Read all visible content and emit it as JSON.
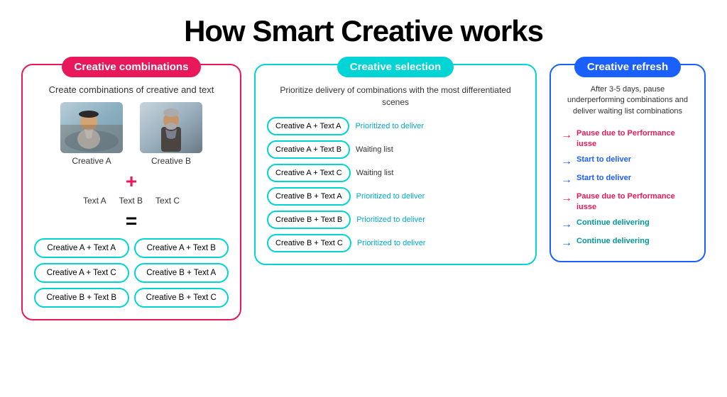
{
  "page": {
    "title": "How Smart Creative works"
  },
  "left": {
    "header": "Creative combinations",
    "create_text": "Create combinations of creative and text",
    "creative_a_label": "Creative A",
    "creative_b_label": "Creative B",
    "plus": "+",
    "texts": [
      "Text A",
      "Text B",
      "Text C"
    ],
    "equals": "=",
    "combos": [
      "Creative A + Text A",
      "Creative A + Text B",
      "Creative A + Text C",
      "Creative B + Text A",
      "Creative B + Text B",
      "Creative B + Text C"
    ]
  },
  "middle": {
    "header": "Creative selection",
    "desc": "Prioritize delivery of combinations with the most differentiated scenes",
    "rows": [
      {
        "pill": "Creative A + Text A",
        "status": "Prioritized to deliver",
        "type": "prioritized"
      },
      {
        "pill": "Creative A + Text B",
        "status": "Waiting list",
        "type": "waiting"
      },
      {
        "pill": "Creative A + Text C",
        "status": "Waiting list",
        "type": "waiting"
      },
      {
        "pill": "Creative B + Text A",
        "status": "Prioritized to deliver",
        "type": "prioritized"
      },
      {
        "pill": "Creative B + Text B",
        "status": "Prioritized to deliver",
        "type": "prioritized"
      },
      {
        "pill": "Creative B + Text C",
        "status": "Prioritized to deliver",
        "type": "prioritized"
      }
    ]
  },
  "right": {
    "header": "Creative refresh",
    "desc": "After 3-5 days, pause underperforming combinations and deliver waiting list combinations",
    "rows": [
      {
        "text": "Pause due to Performance iusse",
        "type": "red"
      },
      {
        "text": "Start to deliver",
        "type": "blue"
      },
      {
        "text": "Start to deliver",
        "type": "blue"
      },
      {
        "text": "Pause due to Performance iusse",
        "type": "red"
      },
      {
        "text": "Continue delivering",
        "type": "teal"
      },
      {
        "text": "Continue delivering",
        "type": "teal"
      }
    ]
  }
}
